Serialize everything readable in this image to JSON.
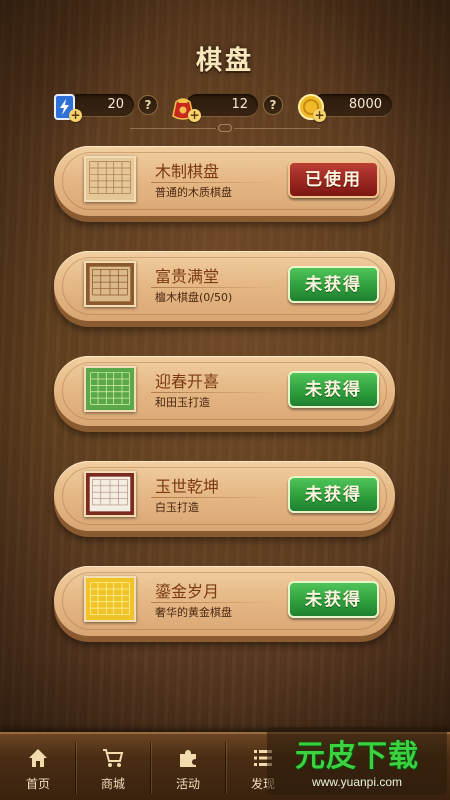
{
  "header": {
    "title": "棋盘"
  },
  "currencies": [
    {
      "icon": "energy-card-icon",
      "value": "20",
      "help": "?"
    },
    {
      "icon": "lucky-bag-icon",
      "value": "12",
      "help": "?"
    },
    {
      "icon": "gold-coin-icon",
      "value": "8000"
    }
  ],
  "boards": [
    {
      "name": "木制棋盘",
      "desc": "普通的木质棋盘",
      "button": "已使用",
      "status": "used",
      "theme": "wood-light"
    },
    {
      "name": "富贵满堂",
      "desc": "檀木棋盘(0/50)",
      "button": "未获得",
      "status": "locked",
      "theme": "sandalwood"
    },
    {
      "name": "迎春开喜",
      "desc": "和田玉打造",
      "button": "未获得",
      "status": "locked",
      "theme": "jade-green"
    },
    {
      "name": "玉世乾坤",
      "desc": "白玉打造",
      "button": "未获得",
      "status": "locked",
      "theme": "white-jade"
    },
    {
      "name": "鎏金岁月",
      "desc": "奢华的黄金棋盘",
      "button": "未获得",
      "status": "locked",
      "theme": "gold"
    }
  ],
  "nav": [
    {
      "label": "首页",
      "icon": "home-icon"
    },
    {
      "label": "商城",
      "icon": "cart-icon"
    },
    {
      "label": "活动",
      "icon": "puzzle-icon"
    },
    {
      "label": "发现",
      "icon": "list-icon"
    }
  ],
  "watermark": {
    "logo": "元皮下载",
    "url": "www.yuanpi.com"
  },
  "colors": {
    "used_button": "#97241e",
    "locked_button": "#2f9f3c",
    "title": "#f7e7bd"
  }
}
